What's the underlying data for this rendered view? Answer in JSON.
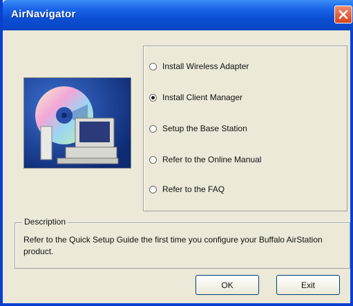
{
  "window": {
    "title": "AirNavigator"
  },
  "options": [
    {
      "label": "Install Wireless Adapter",
      "checked": false
    },
    {
      "label": "Install Client Manager",
      "checked": true
    },
    {
      "label": "Setup the Base Station",
      "checked": false
    },
    {
      "label": "Refer to the Online Manual",
      "checked": false
    },
    {
      "label": "Refer to the FAQ",
      "checked": false
    }
  ],
  "description": {
    "legend": "Description",
    "text": "Refer to the Quick Setup Guide the first time you configure your Buffalo AirStation product."
  },
  "buttons": {
    "ok": "OK",
    "exit": "Exit"
  },
  "icons": {
    "close": "close-icon",
    "illustration": "cd-computer-illustration"
  }
}
